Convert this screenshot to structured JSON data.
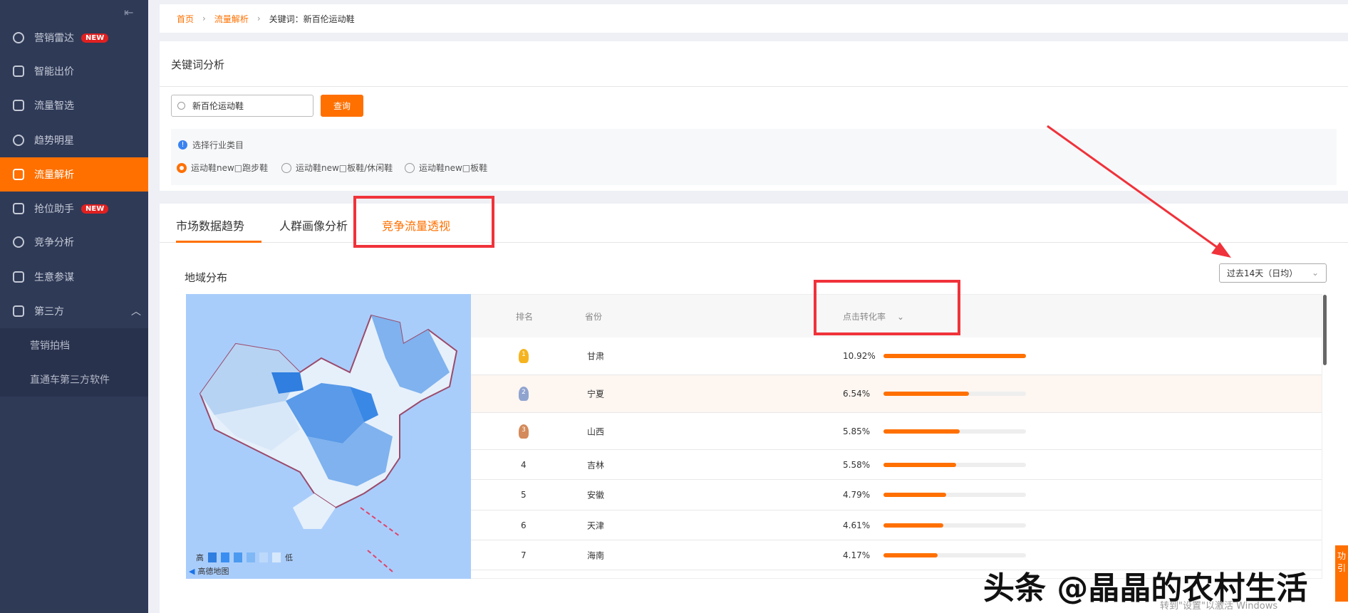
{
  "sidebar": {
    "items": [
      {
        "label": "营销雷达",
        "badge": "NEW"
      },
      {
        "label": "智能出价"
      },
      {
        "label": "流量智选"
      },
      {
        "label": "趋势明星"
      },
      {
        "label": "流量解析"
      },
      {
        "label": "抢位助手",
        "badge": "NEW"
      },
      {
        "label": "竞争分析"
      },
      {
        "label": "生意参谋"
      },
      {
        "label": "第三方"
      }
    ],
    "sub_items": [
      "营销拍档",
      "直通车第三方软件"
    ]
  },
  "breadcrumb": [
    "首页",
    "流量解析",
    "关键词：新百伦运动鞋"
  ],
  "keyword": {
    "title": "关键词分析",
    "search_value": "新百伦运动鞋",
    "query_button": "查询",
    "industry_label": "选择行业类目",
    "options": [
      "运动鞋new□跑步鞋",
      "运动鞋new□板鞋/休闲鞋",
      "运动鞋new□板鞋"
    ]
  },
  "tabs": [
    "市场数据趋势",
    "人群画像分析",
    "竞争流量透视"
  ],
  "region": {
    "title": "地域分布",
    "period": "过去14天（日均）",
    "legend_high": "高",
    "legend_low": "低",
    "map_brand": "高德地图"
  },
  "table": {
    "headers": [
      "排名",
      "省份",
      "点击转化率"
    ],
    "rows": [
      {
        "rank": "1",
        "province": "甘肃",
        "rate": "10.92%",
        "value": 10.92
      },
      {
        "rank": "2",
        "province": "宁夏",
        "rate": "6.54%",
        "value": 6.54
      },
      {
        "rank": "3",
        "province": "山西",
        "rate": "5.85%",
        "value": 5.85
      },
      {
        "rank": "4",
        "province": "吉林",
        "rate": "5.58%",
        "value": 5.58
      },
      {
        "rank": "5",
        "province": "安徽",
        "rate": "4.79%",
        "value": 4.79
      },
      {
        "rank": "6",
        "province": "天津",
        "rate": "4.61%",
        "value": 4.61
      },
      {
        "rank": "7",
        "province": "海南",
        "rate": "4.17%",
        "value": 4.17
      }
    ]
  },
  "watermark": "头条 @晶晶的农村生活",
  "windows_notice": "转到\"设置\"以激活 Windows",
  "side_tab": "功引",
  "colors": {
    "accent": "#ff7000",
    "sidebar": "#2f3a57",
    "annotation": "#f0323a"
  }
}
